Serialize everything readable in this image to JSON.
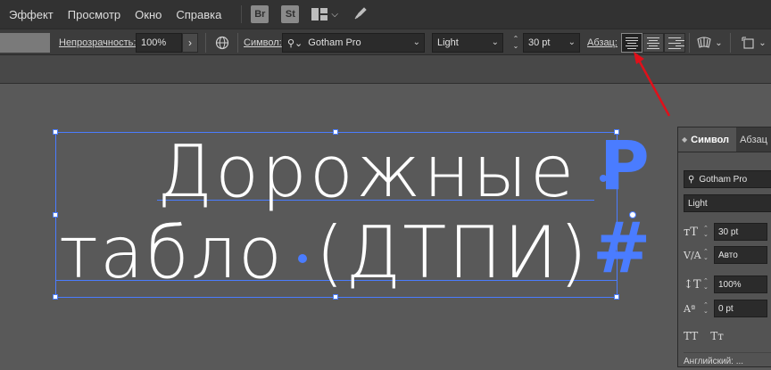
{
  "menu": {
    "items": [
      "Эффект",
      "Просмотр",
      "Окно",
      "Справка"
    ],
    "bridge_icon": "Br",
    "stock_icon": "St"
  },
  "control": {
    "opacity_label": "Непрозрачность:",
    "opacity_value": "100%",
    "character_label": "Символ:",
    "font_family": "Gotham Pro",
    "font_style": "Light",
    "font_size": "30 pt",
    "paragraph_label": "Абзац:"
  },
  "canvas": {
    "line1": "Дорожные",
    "line2": "табло",
    "line2b": "(ДТПИ)",
    "overflow_top": "P",
    "overflow_bottom": "#"
  },
  "panel": {
    "tab_active": "Символ",
    "tab_other": "Абзац",
    "font_family": "Gotham Pro",
    "font_style": "Light",
    "size": "30 pt",
    "kerning": "Авто",
    "vscale": "100%",
    "baseline": "0 pt",
    "tt_caps": "TT",
    "tt_small": "Tт",
    "language": "Английский: ..."
  },
  "colors": {
    "selection": "#4a7cff",
    "arrow": "#e0101a"
  }
}
